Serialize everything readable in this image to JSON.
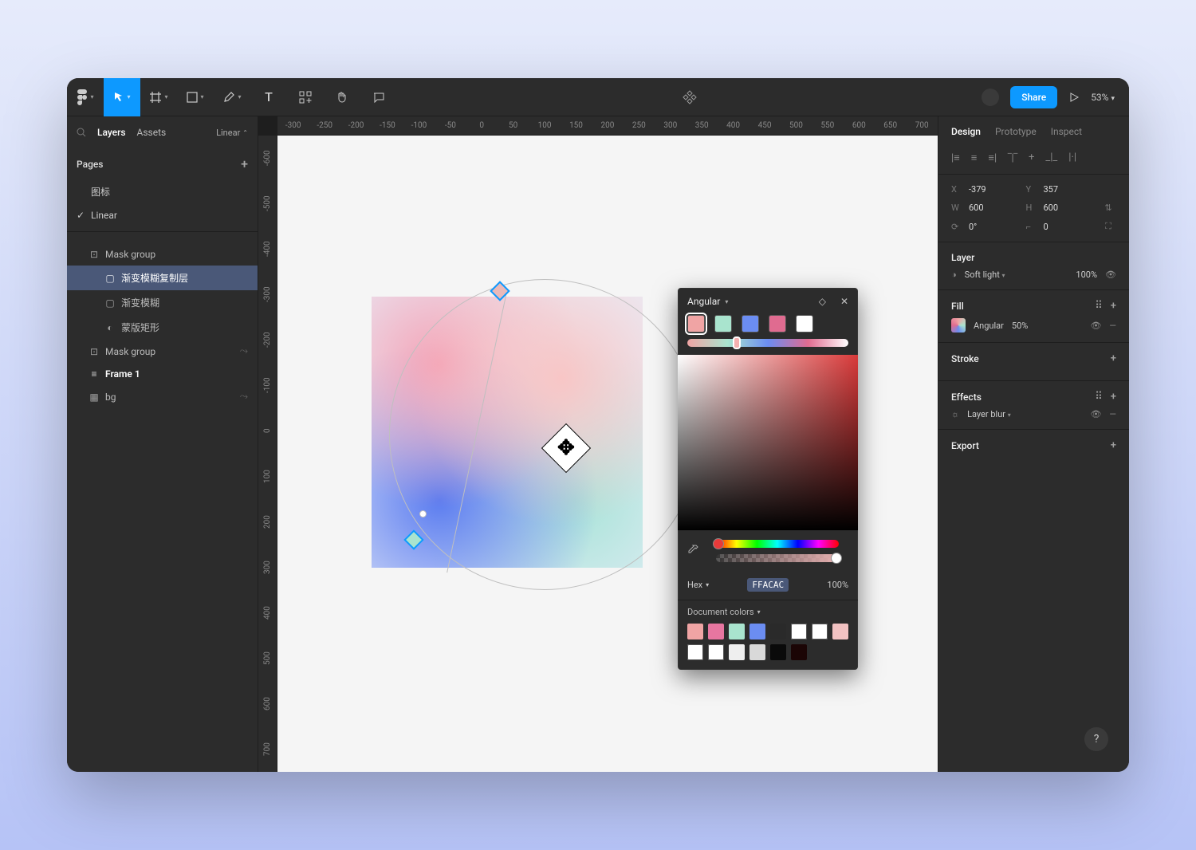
{
  "toolbar": {
    "share_label": "Share",
    "zoom": "53%"
  },
  "left": {
    "tabs": {
      "layers": "Layers",
      "assets": "Assets"
    },
    "filter": "Linear",
    "pages_label": "Pages",
    "pages": [
      {
        "name": "图标",
        "selected": false
      },
      {
        "name": "Linear",
        "selected": true
      }
    ],
    "layers": [
      {
        "depth": 1,
        "icon": "mask",
        "name": "Mask group"
      },
      {
        "depth": 2,
        "icon": "rect",
        "name": "渐变模糊复制层",
        "selected": true
      },
      {
        "depth": 2,
        "icon": "rect",
        "name": "渐变模糊"
      },
      {
        "depth": 2,
        "icon": "mask-shape",
        "name": "蒙版矩形"
      },
      {
        "depth": 1,
        "icon": "mask",
        "name": "Mask group",
        "vis": true
      },
      {
        "depth": 1,
        "icon": "frame",
        "name": "Frame 1",
        "bold": true
      },
      {
        "depth": 1,
        "icon": "image",
        "name": "bg",
        "vis": true
      }
    ]
  },
  "rulers": {
    "h": [
      "-300",
      "-250",
      "-200",
      "-150",
      "-100",
      "-50",
      "0",
      "50",
      "100",
      "150",
      "200",
      "250",
      "300",
      "350",
      "400",
      "450",
      "500",
      "550",
      "600",
      "650",
      "700"
    ],
    "v": [
      "-600",
      "-500",
      "-400",
      "-300",
      "-200",
      "-100",
      "0",
      "100",
      "200",
      "300",
      "400",
      "500",
      "600",
      "700"
    ]
  },
  "colorpanel": {
    "title": "Angular",
    "stops": [
      "#f0a4a4",
      "#a9e4ce",
      "#6b8df2",
      "#e06b90",
      "#ffffff"
    ],
    "selected_stop": 0,
    "mode": "Hex",
    "hex": "FFACAC",
    "opacity": "100%",
    "doc_label": "Document colors",
    "doc_colors": [
      "#f0a4a4",
      "#e776a0",
      "#a9e4ce",
      "#6b8df2",
      "#2a2a2a",
      "#ffffff",
      "#ffffff",
      "#f2c2c2",
      "#ffffff",
      "#ffffff",
      "#efefef",
      "#d9d9d9",
      "#0a0a0a",
      "#1b0505"
    ]
  },
  "right": {
    "tabs": {
      "design": "Design",
      "prototype": "Prototype",
      "inspect": "Inspect"
    },
    "x_label": "X",
    "x_val": "-379",
    "y_label": "Y",
    "y_val": "357",
    "w_label": "W",
    "w_val": "600",
    "h_label": "H",
    "h_val": "600",
    "rot_val": "0°",
    "rad_val": "0",
    "layer_section": "Layer",
    "blend_mode": "Soft light",
    "layer_opacity": "100%",
    "fill_section": "Fill",
    "fill_type": "Angular",
    "fill_opacity": "50%",
    "stroke_section": "Stroke",
    "effects_section": "Effects",
    "effect_name": "Layer blur",
    "export_section": "Export"
  }
}
